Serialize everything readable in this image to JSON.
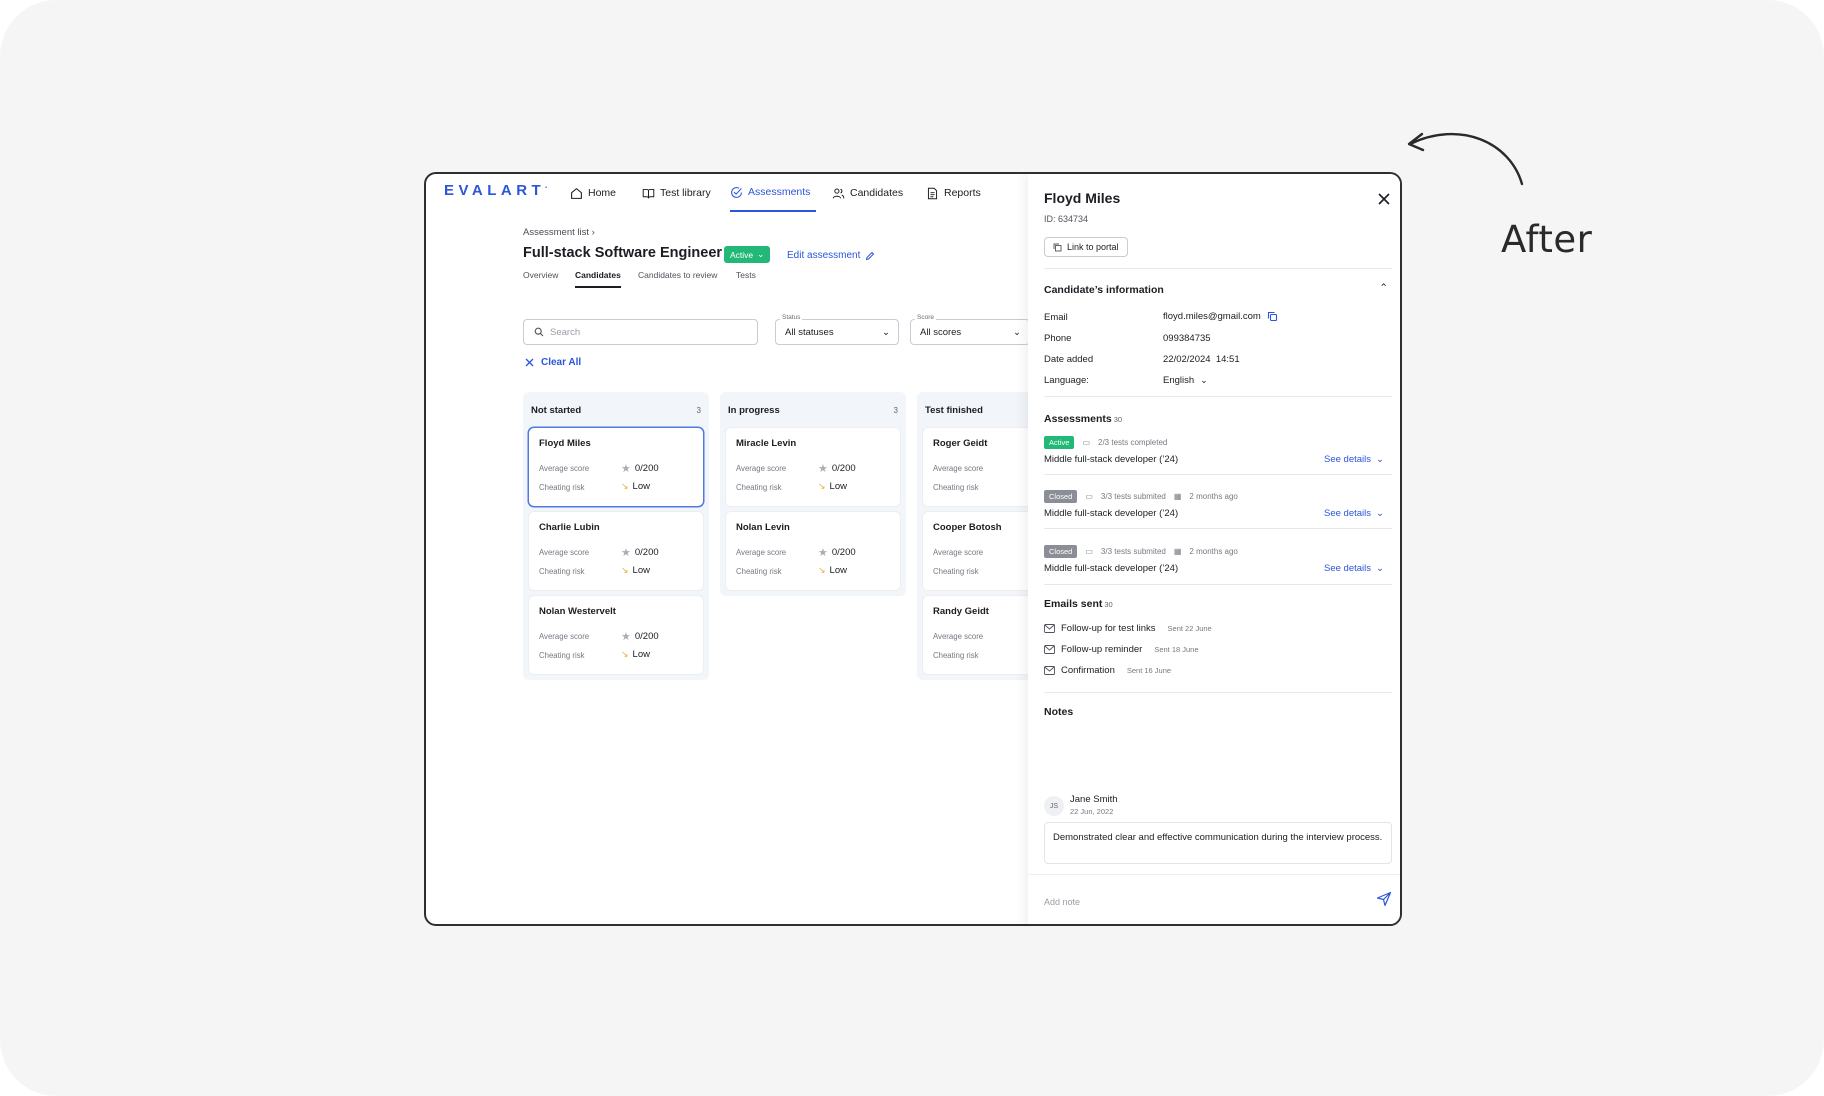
{
  "annotation": {
    "label": "After"
  },
  "app": {
    "logo": "EVALART",
    "nav": [
      {
        "label": "Home",
        "icon": "home-icon"
      },
      {
        "label": "Test library",
        "icon": "book-icon"
      },
      {
        "label": "Assessments",
        "icon": "check-circle-icon",
        "active": true
      },
      {
        "label": "Candidates",
        "icon": "users-icon"
      },
      {
        "label": "Reports",
        "icon": "document-icon"
      }
    ]
  },
  "page": {
    "breadcrumb": "Assessment list",
    "title": "Full-stack Software Engineer",
    "status": "Active",
    "edit_label": "Edit assessment",
    "tabs": [
      "Overview",
      "Candidates",
      "Candidates to review",
      "Tests"
    ],
    "active_tab": "Candidates"
  },
  "filters": {
    "search_placeholder": "Search",
    "status": {
      "label": "Status",
      "value": "All statuses"
    },
    "score": {
      "label": "Score",
      "value": "All scores"
    },
    "clear_label": "Clear All"
  },
  "board": {
    "columns": [
      {
        "title": "Not started",
        "count": "3",
        "cards": [
          {
            "name": "Floyd Miles",
            "avg_label": "Average score",
            "score": "0/200",
            "risk_label": "Cheating risk",
            "risk": "Low",
            "selected": true
          },
          {
            "name": "Charlie Lubin",
            "avg_label": "Average score",
            "score": "0/200",
            "risk_label": "Cheating risk",
            "risk": "Low"
          },
          {
            "name": "Nolan Westervelt",
            "avg_label": "Average score",
            "score": "0/200",
            "risk_label": "Cheating risk",
            "risk": "Low"
          }
        ]
      },
      {
        "title": "In progress",
        "count": "3",
        "cards": [
          {
            "name": "Miracle Levin",
            "avg_label": "Average score",
            "score": "0/200",
            "risk_label": "Cheating risk",
            "risk": "Low"
          },
          {
            "name": "Nolan Levin",
            "avg_label": "Average score",
            "score": "0/200",
            "risk_label": "Cheating risk",
            "risk": "Low"
          }
        ]
      },
      {
        "title": "Test finished",
        "count": "",
        "cards": [
          {
            "name": "Roger Geidt",
            "avg_label": "Average score",
            "risk_label": "Cheating risk"
          },
          {
            "name": "Cooper Botosh",
            "avg_label": "Average score",
            "risk_label": "Cheating risk"
          },
          {
            "name": "Randy Geidt",
            "avg_label": "Average score",
            "risk_label": "Cheating risk"
          }
        ]
      }
    ]
  },
  "panel": {
    "name": "Floyd Miles",
    "id": "ID: 634734",
    "portal_label": "Link to portal",
    "info_title": "Candidate’s information",
    "info": [
      {
        "key": "Email",
        "value": "floyd.miles@gmail.com"
      },
      {
        "key": "Phone",
        "value": "099384735"
      },
      {
        "key": "Date added",
        "value": "22/02/2024  14:51"
      },
      {
        "key": "Language:",
        "value": "English"
      }
    ],
    "assessments_title": "Assessments",
    "assessments_count": "30",
    "assessments": [
      {
        "status": "Active",
        "tests": "2/3 tests completed",
        "date": "",
        "title": "Middle full-stack developer (’24)",
        "see": "See details"
      },
      {
        "status": "Closed",
        "tests": "3/3 tests submited",
        "date": "2 months ago",
        "title": "Middle full-stack developer (’24)",
        "see": "See details"
      },
      {
        "status": "Closed",
        "tests": "3/3 tests submited",
        "date": "2 months ago",
        "title": "Middle full-stack developer (’24)",
        "see": "See details"
      }
    ],
    "emails_title": "Emails sent",
    "emails_count": "30",
    "emails": [
      {
        "subject": "Follow-up for test links",
        "sent": "Sent 22 June"
      },
      {
        "subject": "Follow-up reminder",
        "sent": "Sent 18 June"
      },
      {
        "subject": "Confirmation",
        "sent": "Sent 16 June"
      }
    ],
    "notes_title": "Notes",
    "note": {
      "initials": "JS",
      "author": "Jane Smith",
      "date": "22 Jun, 2022",
      "text": "Demonstrated clear and effective communication during the interview process."
    },
    "add_note_placeholder": "Add note"
  }
}
